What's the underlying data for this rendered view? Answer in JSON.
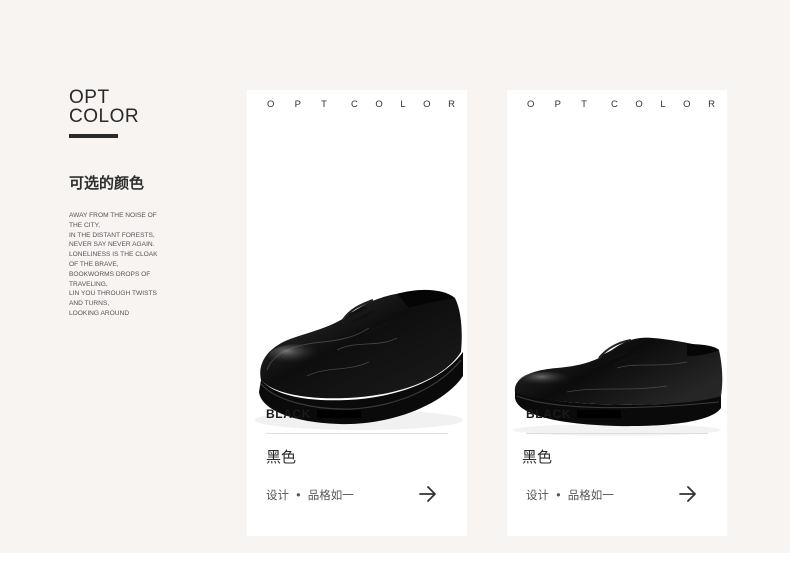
{
  "intro": {
    "title_line1": "OPT",
    "title_line2": "COLOR",
    "subtitle_cn": "可选的颜色",
    "paragraph_lines": [
      "AWAY FROM THE NOISE OF",
      "THE CITY,",
      "IN THE DISTANT FORESTS,",
      "NEVER SAY NEVER AGAIN.",
      "LONELINESS IS THE CLOAK",
      "OF THE BRAVE,",
      "BOOKWORMS DROPS OF",
      "TRAVELING,",
      "LIN YOU THROUGH TWISTS",
      "AND TURNS,",
      "LOOKING AROUND"
    ]
  },
  "cards": [
    {
      "heading_word1": [
        "O",
        "P",
        "T"
      ],
      "heading_word2": [
        "C",
        "O",
        "L",
        "O",
        "R"
      ],
      "color_name": "BLACK",
      "swatch_color": "#000000",
      "color_cn": "黑色",
      "footer_part1": "设计",
      "footer_dot": "•",
      "footer_part2": "品格如一",
      "arrow_icon": "arrow-right-icon",
      "image": "black-leather-derby-shoe-three-quarter-view"
    },
    {
      "heading_word1": [
        "O",
        "P",
        "T"
      ],
      "heading_word2": [
        "C",
        "O",
        "L",
        "O",
        "R"
      ],
      "color_name": "BLACK",
      "swatch_color": "#000000",
      "color_cn": "黑色",
      "footer_part1": "设计",
      "footer_dot": "•",
      "footer_part2": "品格如一",
      "arrow_icon": "arrow-right-icon",
      "image": "black-leather-derby-shoe-side-view"
    }
  ],
  "colors": {
    "background": "#f7f4f2",
    "card": "#ffffff",
    "text": "#2a2a2a"
  }
}
